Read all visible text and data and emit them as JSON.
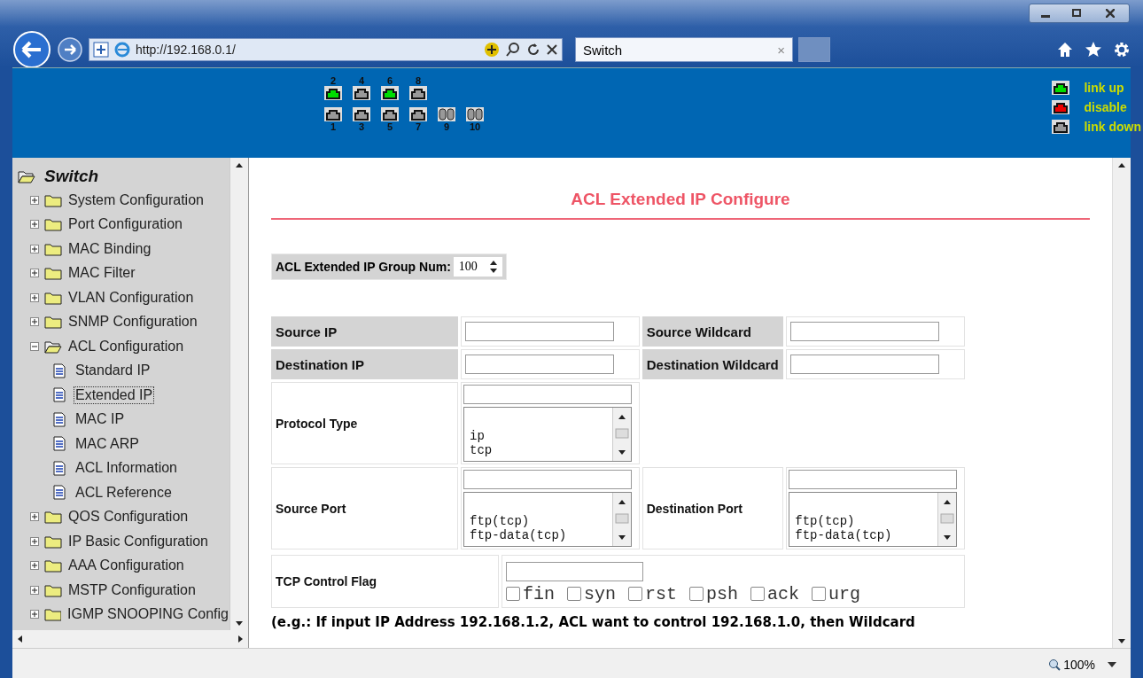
{
  "browser": {
    "address": "http://192.168.0.1/",
    "tab_title": "Switch",
    "tab_close": "×",
    "zoom": "100%"
  },
  "banner": {
    "top_ports": [
      {
        "number": "2",
        "color": "#00dd00",
        "kind": "rj45"
      },
      {
        "number": "4",
        "color": "#999999",
        "kind": "rj45"
      },
      {
        "number": "6",
        "color": "#00dd00",
        "kind": "rj45"
      },
      {
        "number": "8",
        "color": "#999999",
        "kind": "rj45"
      }
    ],
    "bottom_ports": [
      {
        "number": "1",
        "color": "#999999",
        "kind": "rj45"
      },
      {
        "number": "3",
        "color": "#999999",
        "kind": "rj45"
      },
      {
        "number": "5",
        "color": "#999999",
        "kind": "rj45"
      },
      {
        "number": "7",
        "color": "#999999",
        "kind": "rj45"
      },
      {
        "number": "9",
        "color": "#999999",
        "kind": "fiber"
      },
      {
        "number": "10",
        "color": "#999999",
        "kind": "fiber"
      }
    ],
    "legend": [
      {
        "color": "#00dd00",
        "label": "link up"
      },
      {
        "color": "#ee0000",
        "label": "disable"
      },
      {
        "color": "#999999",
        "label": "link down"
      }
    ]
  },
  "tree": {
    "root": "Switch",
    "items": [
      {
        "label": "System Configuration",
        "expanded": false,
        "selected": false
      },
      {
        "label": "Port Configuration",
        "expanded": false,
        "selected": false
      },
      {
        "label": "MAC Binding",
        "expanded": false,
        "selected": false
      },
      {
        "label": "MAC Filter",
        "expanded": false,
        "selected": false
      },
      {
        "label": "VLAN Configuration",
        "expanded": false,
        "selected": false
      },
      {
        "label": "SNMP Configuration",
        "expanded": false,
        "selected": false
      },
      {
        "label": "ACL Configuration",
        "expanded": true,
        "selected": false,
        "children": [
          {
            "label": "Standard IP",
            "selected": false
          },
          {
            "label": "Extended IP",
            "selected": true
          },
          {
            "label": "MAC IP",
            "selected": false
          },
          {
            "label": "MAC ARP",
            "selected": false
          },
          {
            "label": "ACL Information",
            "selected": false
          },
          {
            "label": "ACL Reference",
            "selected": false
          }
        ]
      },
      {
        "label": "QOS Configuration",
        "expanded": false,
        "selected": false
      },
      {
        "label": "IP Basic Configuration",
        "expanded": false,
        "selected": false
      },
      {
        "label": "AAA Configuration",
        "expanded": false,
        "selected": false
      },
      {
        "label": "MSTP Configuration",
        "expanded": false,
        "selected": false
      },
      {
        "label": "IGMP SNOOPING Config",
        "expanded": false,
        "selected": false
      }
    ]
  },
  "form": {
    "title": "ACL Extended IP Configure",
    "group_label": "ACL Extended IP Group Num:",
    "group_value": "100",
    "source_ip": {
      "label": "Source IP"
    },
    "source_wildcard": {
      "label": "Source Wildcard"
    },
    "destination_ip": {
      "label": "Destination IP"
    },
    "destination_wildcard": {
      "label": "Destination Wildcard"
    },
    "protocol_type": {
      "label": "Protocol Type",
      "options": [
        "ip",
        "tcp"
      ]
    },
    "source_port": {
      "label": "Source Port",
      "options": [
        "ftp(tcp)",
        "ftp-data(tcp)"
      ]
    },
    "destination_port": {
      "label": "Destination Port",
      "options": [
        "ftp(tcp)",
        "ftp-data(tcp)"
      ]
    },
    "tcp_control_flag": {
      "label": "TCP Control Flag",
      "flags": [
        {
          "label": "fin",
          "checked": false
        },
        {
          "label": "syn",
          "checked": false
        },
        {
          "label": "rst",
          "checked": false
        },
        {
          "label": "psh",
          "checked": false
        },
        {
          "label": "ack",
          "checked": false
        },
        {
          "label": "urg",
          "checked": false
        }
      ]
    },
    "note": "(e.g.: If input IP Address 192.168.1.2, ACL want to control 192.168.1.0, then Wildcard"
  }
}
